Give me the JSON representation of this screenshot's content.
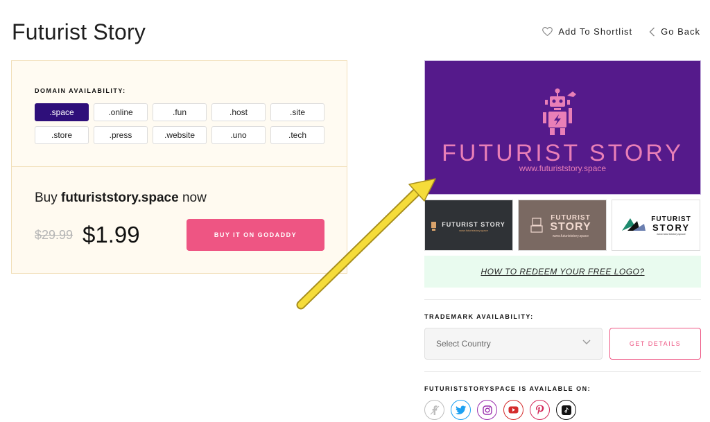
{
  "header": {
    "title": "Futurist Story",
    "shortlist_label": "Add To Shortlist",
    "back_label": "Go Back"
  },
  "domain": {
    "label": "DOMAIN AVAILABILITY:",
    "tlds": [
      ".space",
      ".online",
      ".fun",
      ".host",
      ".site",
      ".store",
      ".press",
      ".website",
      ".uno",
      ".tech"
    ],
    "selected_tld": ".space",
    "buy_prefix": "Buy",
    "buy_domain": "futuriststory.space",
    "buy_suffix": "now",
    "old_price": "$29.99",
    "new_price": "$1.99",
    "buy_button": "BUY IT ON GODADDY"
  },
  "logo": {
    "title": "FUTURIST STORY",
    "url": "www.futuriststory.space",
    "background": "#551a8b",
    "accent": "#e97fb7",
    "thumbnails": [
      {
        "title": "FUTURIST STORY",
        "sub": "www.futuriststory.space"
      },
      {
        "title_line1": "FUTURIST",
        "title_line2": "STORY",
        "sub": "www.futuriststory.space"
      },
      {
        "title_line1": "FUTURIST",
        "title_line2": "STORY",
        "sub": "www.futuriststory.space"
      }
    ],
    "redeem_link": "HOW TO REDEEM YOUR FREE LOGO?"
  },
  "trademark": {
    "label": "TRADEMARK AVAILABILITY:",
    "select_placeholder": "Select Country",
    "details_button": "GET DETAILS"
  },
  "availability": {
    "label": "FUTURISTSTORYSPACE IS AVAILABLE ON:",
    "networks": [
      "facebook-icon",
      "twitter-icon",
      "instagram-icon",
      "youtube-icon",
      "pinterest-icon",
      "tiktok-icon"
    ]
  },
  "colors": {
    "brand_pink": "#ee5583",
    "selected_tld": "#2e0f7a",
    "arrow": "#f5dc3a"
  }
}
